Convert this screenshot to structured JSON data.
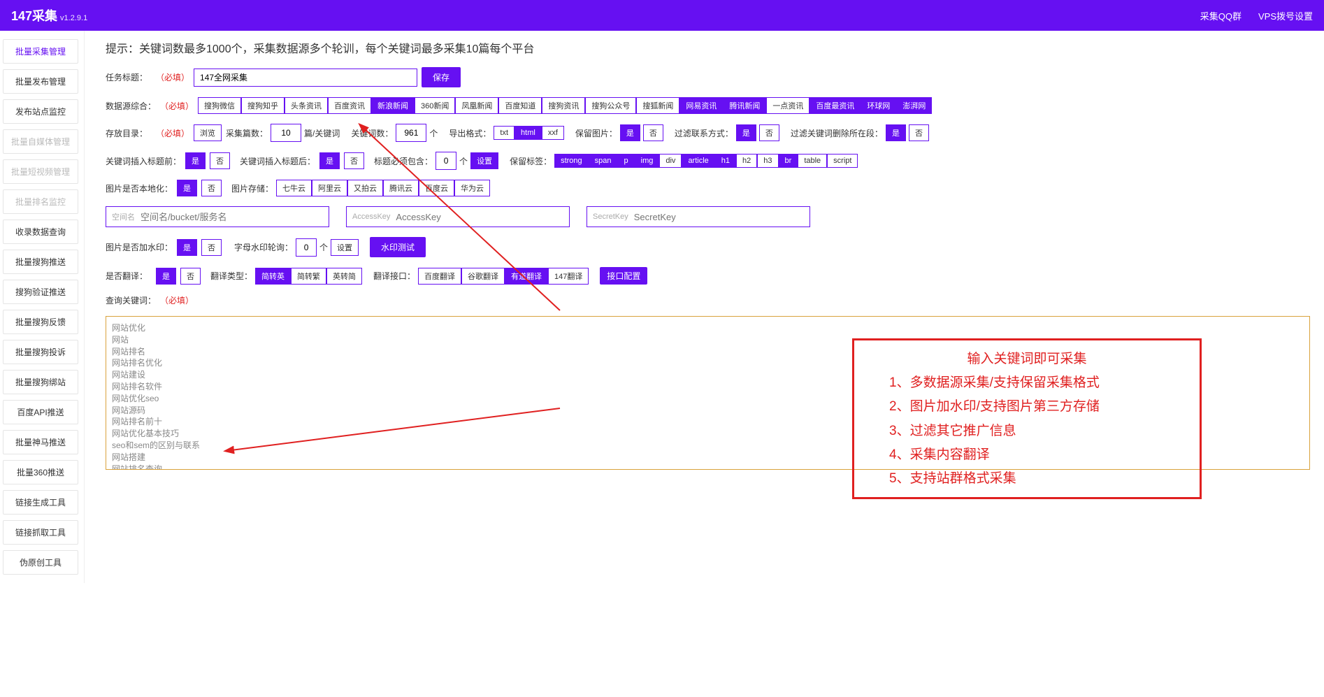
{
  "header": {
    "brand": "147采集",
    "version": "v1.2.9.1",
    "right": {
      "qq": "采集QQ群",
      "vps": "VPS拨号设置"
    }
  },
  "sidebar": [
    {
      "label": "批量采集管理",
      "active": true
    },
    {
      "label": "批量发布管理"
    },
    {
      "label": "发布站点监控"
    },
    {
      "label": "批量自媒体管理",
      "disabled": true
    },
    {
      "label": "批量短视频管理",
      "disabled": true
    },
    {
      "label": "批量排名监控",
      "disabled": true
    },
    {
      "label": "收录数据查询"
    },
    {
      "label": "批量搜狗推送"
    },
    {
      "label": "搜狗验证推送"
    },
    {
      "label": "批量搜狗反馈"
    },
    {
      "label": "批量搜狗投诉"
    },
    {
      "label": "批量搜狗绑站"
    },
    {
      "label": "百度API推送"
    },
    {
      "label": "批量神马推送"
    },
    {
      "label": "批量360推送"
    },
    {
      "label": "链接生成工具"
    },
    {
      "label": "链接抓取工具"
    },
    {
      "label": "伪原创工具"
    }
  ],
  "hint": "提示：关键词数最多1000个，采集数据源多个轮训，每个关键词最多采集10篇每个平台",
  "task": {
    "label": "任务标题：",
    "req": "（必填）",
    "value": "147全网采集",
    "save": "保存"
  },
  "sources": {
    "label": "数据源综合：",
    "req": "（必填）",
    "items": [
      {
        "t": "搜狗微信",
        "on": false
      },
      {
        "t": "搜狗知乎",
        "on": false
      },
      {
        "t": "头条资讯",
        "on": false
      },
      {
        "t": "百度资讯",
        "on": false
      },
      {
        "t": "新浪新闻",
        "on": true
      },
      {
        "t": "360新闻",
        "on": false
      },
      {
        "t": "凤凰新闻",
        "on": false
      },
      {
        "t": "百度知道",
        "on": false
      },
      {
        "t": "搜狗资讯",
        "on": false
      },
      {
        "t": "搜狗公众号",
        "on": false
      },
      {
        "t": "搜狐新闻",
        "on": false
      },
      {
        "t": "网易资讯",
        "on": true
      },
      {
        "t": "腾讯新闻",
        "on": true
      },
      {
        "t": "一点资讯",
        "on": false
      },
      {
        "t": "百度最资讯",
        "on": true
      },
      {
        "t": "环球网",
        "on": true
      },
      {
        "t": "澎湃网",
        "on": true
      }
    ]
  },
  "row_save": {
    "dir_label": "存放目录：",
    "req": "（必填）",
    "browse": "浏览",
    "count_label": "采集篇数：",
    "count_value": "10",
    "count_unit": "篇/关键词",
    "kw_label": "关键词数：",
    "kw_value": "961",
    "kw_unit": "个",
    "fmt_label": "导出格式：",
    "fmt": [
      {
        "t": "txt"
      },
      {
        "t": "html",
        "on": true
      },
      {
        "t": "xxf"
      }
    ],
    "img_label": "保留图片：",
    "yes": "是",
    "no": "否",
    "contact_label": "过滤联系方式：",
    "filter_kw_label": "过滤关键词删除所在段："
  },
  "row_insert": {
    "before_label": "关键词插入标题前：",
    "after_label": "关键词插入标题后：",
    "must_label": "标题必须包含：",
    "must_value": "0",
    "must_unit": "个",
    "setting": "设置",
    "keep_label": "保留标签：",
    "tags": [
      {
        "t": "strong",
        "on": true
      },
      {
        "t": "span",
        "on": true
      },
      {
        "t": "p",
        "on": true
      },
      {
        "t": "img",
        "on": true
      },
      {
        "t": "div",
        "on": false
      },
      {
        "t": "article",
        "on": true
      },
      {
        "t": "h1",
        "on": true
      },
      {
        "t": "h2",
        "on": false
      },
      {
        "t": "h3",
        "on": false
      },
      {
        "t": "br",
        "on": true
      },
      {
        "t": "table",
        "on": false
      },
      {
        "t": "script",
        "on": false
      }
    ]
  },
  "row_img": {
    "local_label": "图片是否本地化：",
    "store_label": "图片存储：",
    "clouds": [
      {
        "t": "七牛云"
      },
      {
        "t": "阿里云"
      },
      {
        "t": "又拍云"
      },
      {
        "t": "腾讯云"
      },
      {
        "t": "百度云"
      },
      {
        "t": "华为云"
      }
    ]
  },
  "cloud": {
    "space_pre": "空间名",
    "space_ph": "空间名/bucket/服务名",
    "ak_pre": "AccessKey",
    "ak_ph": "AccessKey",
    "sk_pre": "SecretKey",
    "sk_ph": "SecretKey"
  },
  "row_wm": {
    "label": "图片是否加水印：",
    "alpha_label": "字母水印轮询：",
    "alpha_value": "0",
    "alpha_unit": "个",
    "setting": "设置",
    "test": "水印测试"
  },
  "row_trans": {
    "label": "是否翻译：",
    "type_label": "翻译类型：",
    "types": [
      {
        "t": "简转英",
        "on": true
      },
      {
        "t": "简转繁"
      },
      {
        "t": "英转简"
      }
    ],
    "api_label": "翻译接口：",
    "apis": [
      {
        "t": "百度翻译"
      },
      {
        "t": "谷歌翻译"
      },
      {
        "t": "有道翻译",
        "on": true
      },
      {
        "t": "147翻译"
      }
    ],
    "config": "接口配置"
  },
  "kw": {
    "label": "查询关键词：",
    "req": "（必填）",
    "value": "网站优化\n网站\n网站排名\n网站排名优化\n网站建设\n网站排名软件\n网站优化seo\n网站源码\n网站排名前十\n网站优化基本技巧\nseo和sem的区别与联系\n网站搭建\n网站排名查询\n网站优化培训\nseo是什么意思"
  },
  "annot": {
    "title": "输入关键词即可采集",
    "l1": "1、多数据源采集/支持保留采集格式",
    "l2": "2、图片加水印/支持图片第三方存储",
    "l3": "3、过滤其它推广信息",
    "l4": "4、采集内容翻译",
    "l5": "5、支持站群格式采集"
  },
  "yes": "是",
  "no": "否"
}
